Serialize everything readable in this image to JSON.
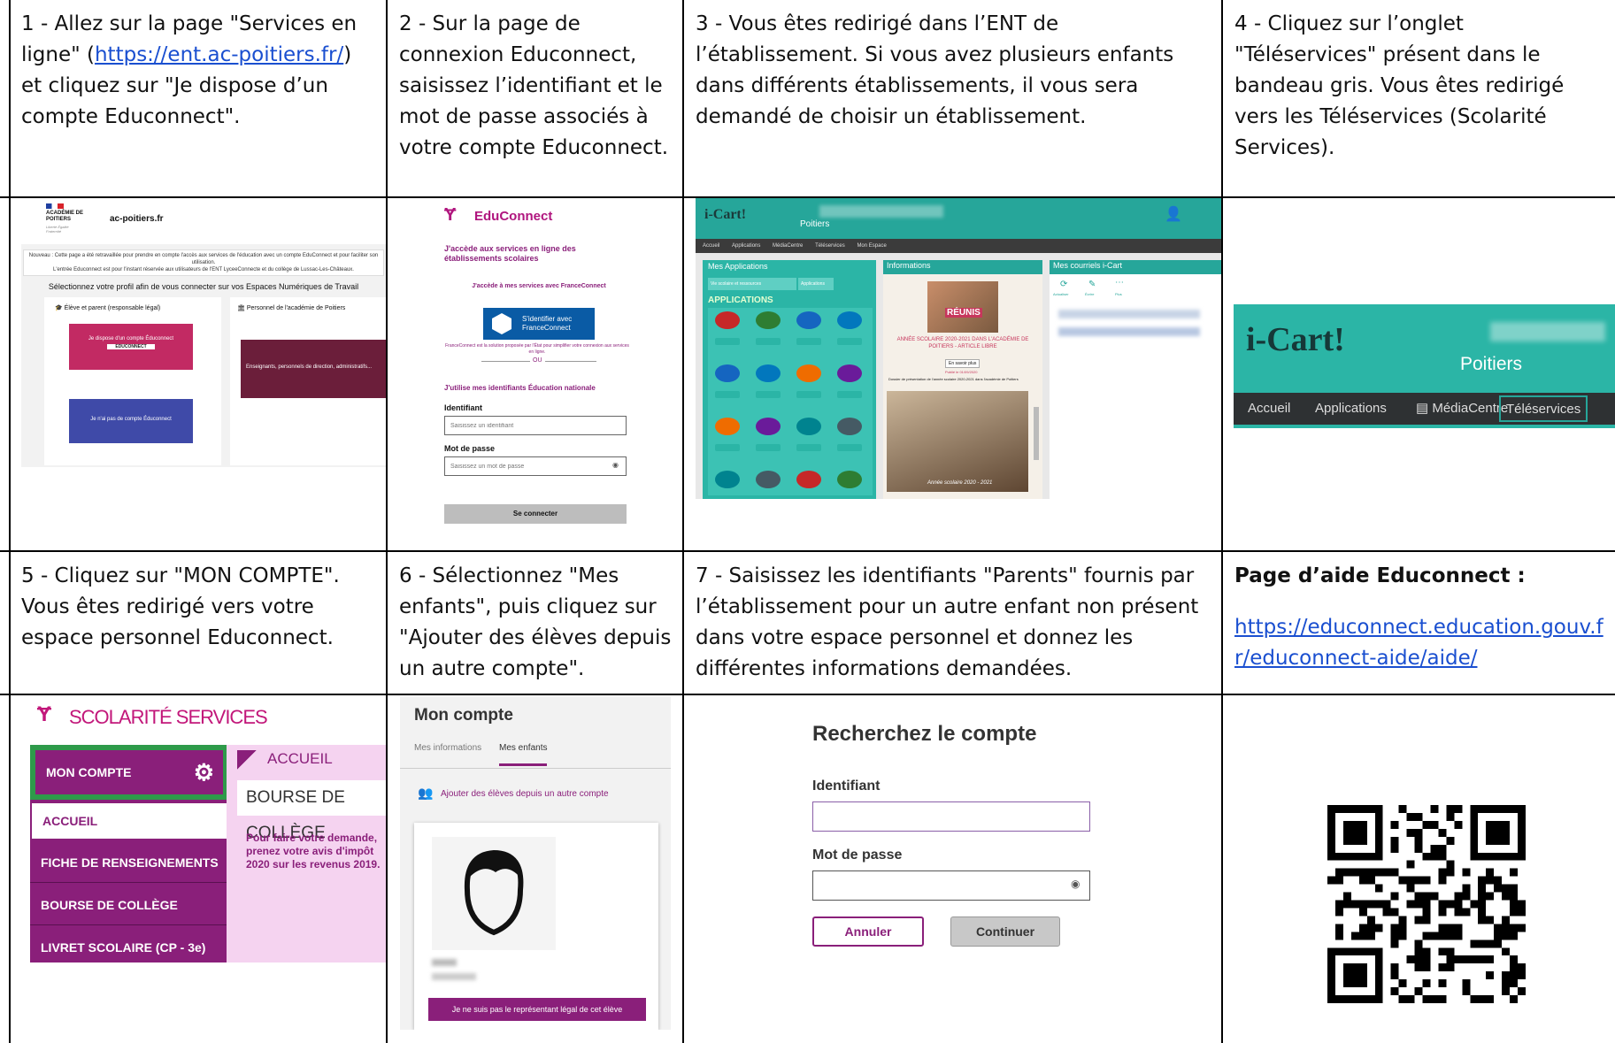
{
  "steps": {
    "s1": {
      "before": "1 - Allez sur la page \"Services en ligne\" (",
      "link": "https://ent.ac-poitiers.fr/",
      "after": ") et cliquez sur \"Je dispose d’un compte Educonnect\"."
    },
    "s2": "2 - Sur la page de connexion Educonnect, saisissez l’identifiant et le mot de passe associés à votre compte Educonnect.",
    "s3": "3 - Vous êtes redirigé dans l’ENT de l’établissement. Si vous avez plusieurs enfants dans différents établissements, il vous sera demandé de choisir un établissement.",
    "s4": "4 - Cliquez sur l’onglet \"Téléservices\" présent dans le bandeau gris. Vous êtes redirigé vers les Téléservices (Scolarité Services).",
    "s5": "5 - Cliquez sur \"MON COMPTE\". Vous êtes redirigé vers votre espace personnel Educonnect.",
    "s6": "6 - Sélectionnez \"Mes enfants\", puis cliquez sur \"Ajouter des élèves depuis un autre compte\".",
    "s7": "7 - Saisissez les identifiants \"Parents\" fournis par l’établissement pour un autre enfant non présent dans votre espace personnel et donnez les différentes informations demandées.",
    "help_title": "Page d’aide Educonnect :",
    "help_link": "https://educonnect.education.gouv.fr/educonnect-aide/aide/"
  },
  "acpoitiers": {
    "logo": "ACADÉMIE DE POITIERS",
    "logo_sub": "Liberté Égalité Fraternité",
    "site": "ac-poitiers.fr",
    "notice": "Nouveau : Cette page a été retravaillée pour prendre en compte l'accès aux services de l'éducation avec un compte EduConnect et pour faciliter son utilisation.",
    "notice2": "L'entrée Educonnect est pour l'instant réservée aux utilisateurs de l'ENT LyceeConnecte et du collège de Lussac-Les-Châteaux.",
    "select_profile": "Sélectionnez votre profil afin de vous connecter sur vos Espaces Numériques de Travail",
    "profile_parent": "Élève et parent (responsable légal)",
    "profile_staff": "Personnel de l'académie de Poitiers",
    "btn_have": "Je dispose d'un compte Éduconnect",
    "btn_have_sub": "EDUCONNECT",
    "btn_nothave": "Je n'ai pas de compte Éduconnect",
    "btn_staff": "Enseignants, personnels de direction, administratifs..."
  },
  "educonnect": {
    "brand": "EduConnect",
    "heading": "J'accède aux services en ligne des établissements scolaires",
    "fc_title": "J'accède à mes services avec FranceConnect",
    "fc_button": "S'identifier avec FranceConnect",
    "fc_desc": "FranceConnect est la solution proposée par l'État pour simplifier votre connexion aux services en ligne.",
    "or": "OU",
    "en_title": "J'utilise mes identifiants Éducation nationale",
    "id_label": "Identifiant",
    "id_placeholder": "Saisissez un identifiant",
    "pw_label": "Mot de passe",
    "pw_placeholder": "Saisissez un mot de passe",
    "submit": "Se connecter"
  },
  "icart": {
    "brand": "i-Cart!",
    "city": "Poitiers",
    "nav": [
      "Accueil",
      "Applications",
      "MédiaCentre",
      "Téléservices",
      "Mon Espace"
    ],
    "panel_apps": "Mes Applications",
    "apps_tab1": "Vie scolaire et ressources",
    "apps_tab2": "Applications",
    "apps_heading": "APPLICATIONS",
    "panel_info": "Informations",
    "reunis": "RÉUNIS",
    "info_title": "ANNÉE SCOLAIRE 2020-2021 DANS L'ACADÉMIE DE POITIERS - ARTICLE LIBRE",
    "info_more": "En savoir plus",
    "info_date": "Publié le 01/09/2020",
    "info_desc": "Dossier de présentation de l'année scolaire 2020-2021 dans l'académie de Poitiers",
    "info_photo": "Année scolaire 2020 - 2021",
    "panel_mail": "Mes courriels i-Cart",
    "mail_actions": [
      "Actualiser",
      "Écrire",
      "Plus"
    ]
  },
  "icart_zoom": {
    "brand": "i-Cart!",
    "city": "Poitiers",
    "nav": [
      "Accueil",
      "Applications",
      "MédiaCentre",
      "Téléservices"
    ]
  },
  "scolarite": {
    "brand": "SCOLARITÉ SERVICES",
    "menu": [
      "MON COMPTE",
      "ACCUEIL",
      "FICHE DE RENSEIGNEMENTS",
      "BOURSE DE COLLÈGE",
      "LIVRET SCOLAIRE (CP - 3e)"
    ],
    "crumb": "ACCUEIL",
    "card_title": "BOURSE DE COLLÈGE",
    "card_text": "Pour faire votre demande, prenez votre avis d'impôt 2020 sur les revenus 2019."
  },
  "moncompte": {
    "title": "Mon compte",
    "tab_info": "Mes informations",
    "tab_children": "Mes enfants",
    "add_link": "Ajouter des élèves depuis un autre compte",
    "not_legal": "Je ne suis pas le représentant légal de cet élève"
  },
  "recherche": {
    "title": "Recherchez le compte",
    "id_label": "Identifiant",
    "pw_label": "Mot de passe",
    "cancel": "Annuler",
    "continue": "Continuer"
  },
  "colors": {
    "teal": "#26a69a",
    "purple": "#8a1f7a",
    "educonnect_purple": "#b0157e",
    "link": "#1a4fd0"
  }
}
